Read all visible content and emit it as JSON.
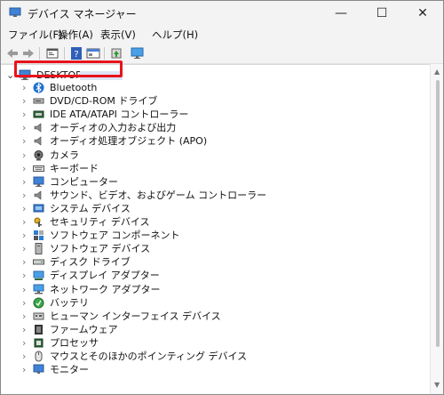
{
  "window": {
    "title": "デバイス マネージャー",
    "controls": {
      "minimize": "—",
      "maximize": "☐",
      "close": "✕"
    }
  },
  "menu": [
    "ファイル(F)",
    "操作(A)",
    "表示(V)",
    "ヘルプ(H)"
  ],
  "tree": {
    "root": "DESKTOP-",
    "items": [
      {
        "label": "Bluetooth",
        "icon": "bluetooth-icon"
      },
      {
        "label": "DVD/CD-ROM ドライブ",
        "icon": "dvd-drive-icon"
      },
      {
        "label": "IDE ATA/ATAPI コントローラー",
        "icon": "ide-controller-icon"
      },
      {
        "label": "オーディオの入力および出力",
        "icon": "speaker-icon"
      },
      {
        "label": "オーディオ処理オブジェクト (APO)",
        "icon": "speaker-icon"
      },
      {
        "label": "カメラ",
        "icon": "camera-icon"
      },
      {
        "label": "キーボード",
        "icon": "keyboard-icon"
      },
      {
        "label": "コンピューター",
        "icon": "computer-icon"
      },
      {
        "label": "サウンド、ビデオ、およびゲーム コントローラー",
        "icon": "speaker-icon"
      },
      {
        "label": "システム デバイス",
        "icon": "system-device-icon"
      },
      {
        "label": "セキュリティ デバイス",
        "icon": "security-key-icon"
      },
      {
        "label": "ソフトウェア コンポーネント",
        "icon": "software-component-icon"
      },
      {
        "label": "ソフトウェア デバイス",
        "icon": "software-device-icon"
      },
      {
        "label": "ディスク ドライブ",
        "icon": "disk-drive-icon"
      },
      {
        "label": "ディスプレイ アダプター",
        "icon": "display-adapter-icon"
      },
      {
        "label": "ネットワーク アダプター",
        "icon": "network-adapter-icon"
      },
      {
        "label": "バッテリ",
        "icon": "battery-icon"
      },
      {
        "label": "ヒューマン インターフェイス デバイス",
        "icon": "hid-icon"
      },
      {
        "label": "ファームウェア",
        "icon": "firmware-icon"
      },
      {
        "label": "プロセッサ",
        "icon": "processor-icon"
      },
      {
        "label": "マウスとそのほかのポインティング デバイス",
        "icon": "mouse-icon"
      },
      {
        "label": "モニター",
        "icon": "monitor-icon"
      }
    ]
  },
  "colors": {
    "highlight": "#e8131b",
    "accent": "#1f6fd0"
  }
}
